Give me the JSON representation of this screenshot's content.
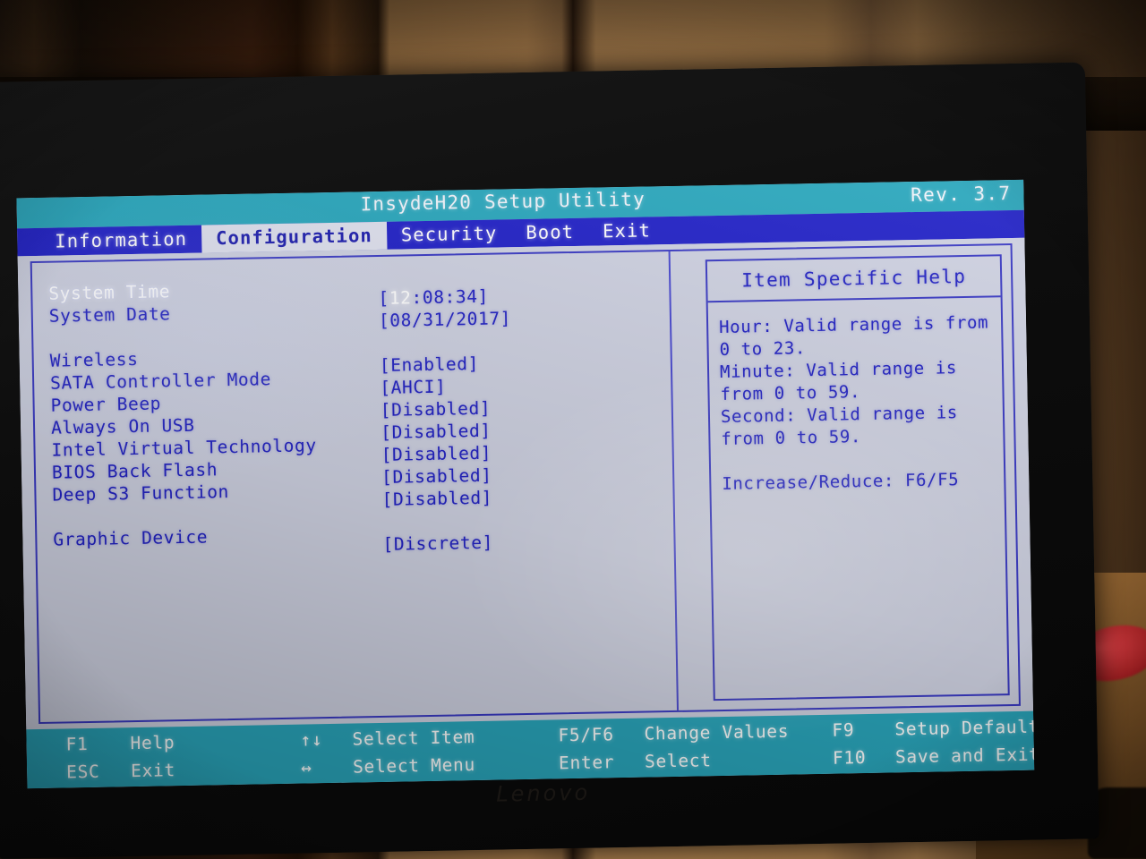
{
  "header": {
    "title": "InsydeH20 Setup Utility",
    "revision": "Rev. 3.7"
  },
  "menu": {
    "items": [
      {
        "label": "Information",
        "selected": false
      },
      {
        "label": "Configuration",
        "selected": true
      },
      {
        "label": "Security",
        "selected": false
      },
      {
        "label": "Boot",
        "selected": false
      },
      {
        "label": "Exit",
        "selected": false
      }
    ]
  },
  "settings": {
    "rows": [
      {
        "label": "System Time",
        "value": "[12:08:34]",
        "selected": true,
        "highlight_value": "12"
      },
      {
        "label": "System Date",
        "value": "[08/31/2017]",
        "selected": false
      },
      {
        "label": "",
        "value": "",
        "selected": false
      },
      {
        "label": "Wireless",
        "value": "[Enabled]",
        "selected": false
      },
      {
        "label": "SATA Controller Mode",
        "value": "[AHCI]",
        "selected": false
      },
      {
        "label": "Power Beep",
        "value": "[Disabled]",
        "selected": false
      },
      {
        "label": "Always On USB",
        "value": "[Disabled]",
        "selected": false
      },
      {
        "label": "Intel Virtual Technology",
        "value": "[Disabled]",
        "selected": false
      },
      {
        "label": "BIOS Back Flash",
        "value": "[Disabled]",
        "selected": false
      },
      {
        "label": "Deep S3 Function",
        "value": "[Disabled]",
        "selected": false
      },
      {
        "label": "",
        "value": "",
        "selected": false
      },
      {
        "label": "Graphic Device",
        "value": "[Discrete]",
        "selected": false
      }
    ]
  },
  "help": {
    "title": "Item Specific Help",
    "lines": [
      "Hour: Valid range is from",
      " 0 to 23.",
      "Minute: Valid range is",
      "from 0 to 59.",
      "Second: Valid range is",
      "from 0 to 59.",
      "",
      "Increase/Reduce: F6/F5"
    ]
  },
  "footer": {
    "cells": [
      "F1",
      "Help",
      "↑↓",
      "Select Item",
      "F5/F6",
      "Change Values",
      "F9",
      "Setup Default",
      "ESC",
      "Exit",
      "↔",
      "Select Menu",
      "Enter",
      "Select",
      "F10",
      "Save and Exit"
    ]
  },
  "device": {
    "brand": "Lenovo"
  },
  "colors": {
    "title_bar": "#2aa7bd",
    "menu_bar": "#2222c8",
    "screen_bg": "#cfd2e2",
    "text_blue": "#2323c4",
    "text_white": "#ffffff",
    "border_blue": "#3a3ac4"
  }
}
